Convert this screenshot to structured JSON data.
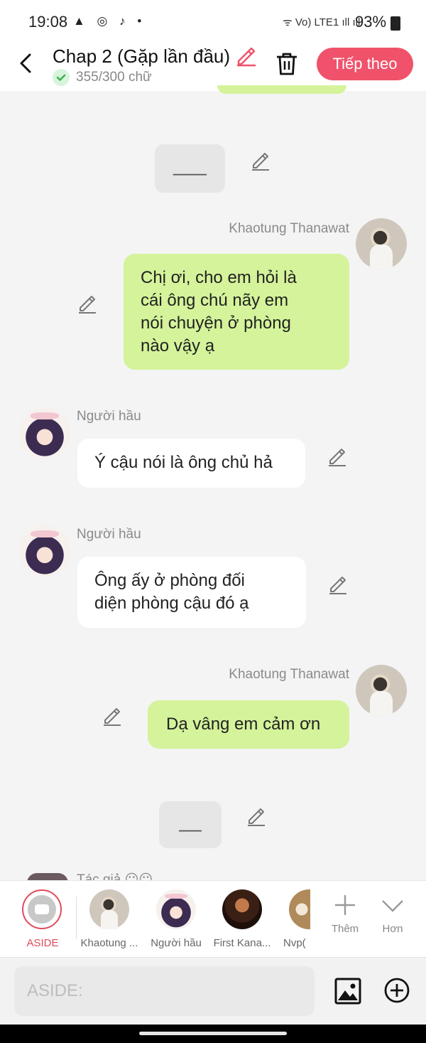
{
  "status_bar": {
    "time": "19:08",
    "notification_icons": "▲ ◎ ♪ •",
    "system_icons": "ᯤ Vo) LTE1 ıll ıll",
    "battery": "93%"
  },
  "header": {
    "title": "Chap 2 (Gặp lần đầu)",
    "word_count": "355/300 chữ",
    "next_label": "Tiếp theo"
  },
  "chat": {
    "scene_breaks": [
      "___",
      "__"
    ],
    "messages": [
      {
        "side": "right",
        "sender": "Khaotung Thanawat",
        "lines": [
          "Chị ơi, cho em hỏi là",
          "cái ông chú nãy em",
          "nói chuyện ở phòng",
          "nào vậy ạ"
        ]
      },
      {
        "side": "left",
        "sender": "Người hầu",
        "lines": [
          "Ý cậu nói là ông chủ hả"
        ]
      },
      {
        "side": "left",
        "sender": "Người hầu",
        "lines": [
          "Ông ấy ở phòng đối",
          "diện phòng cậu đó ạ"
        ]
      },
      {
        "side": "right",
        "sender": "Khaotung Thanawat",
        "lines": [
          "Dạ vâng em cảm ơn"
        ]
      }
    ],
    "partial_next_sender": "Tác giả 😐😐"
  },
  "character_bar": {
    "aside_label": "ASIDE",
    "characters": [
      "Khaotung ...",
      "Người hầu",
      "First Kana...",
      "Nvp("
    ],
    "add_label": "Thêm",
    "more_label": "Hơn"
  },
  "input": {
    "placeholder": "ASIDE:"
  },
  "colors": {
    "accent": "#f0526b",
    "own_bubble": "#d4f39a",
    "other_bubble": "#ffffff",
    "background": "#f4f4f4"
  }
}
